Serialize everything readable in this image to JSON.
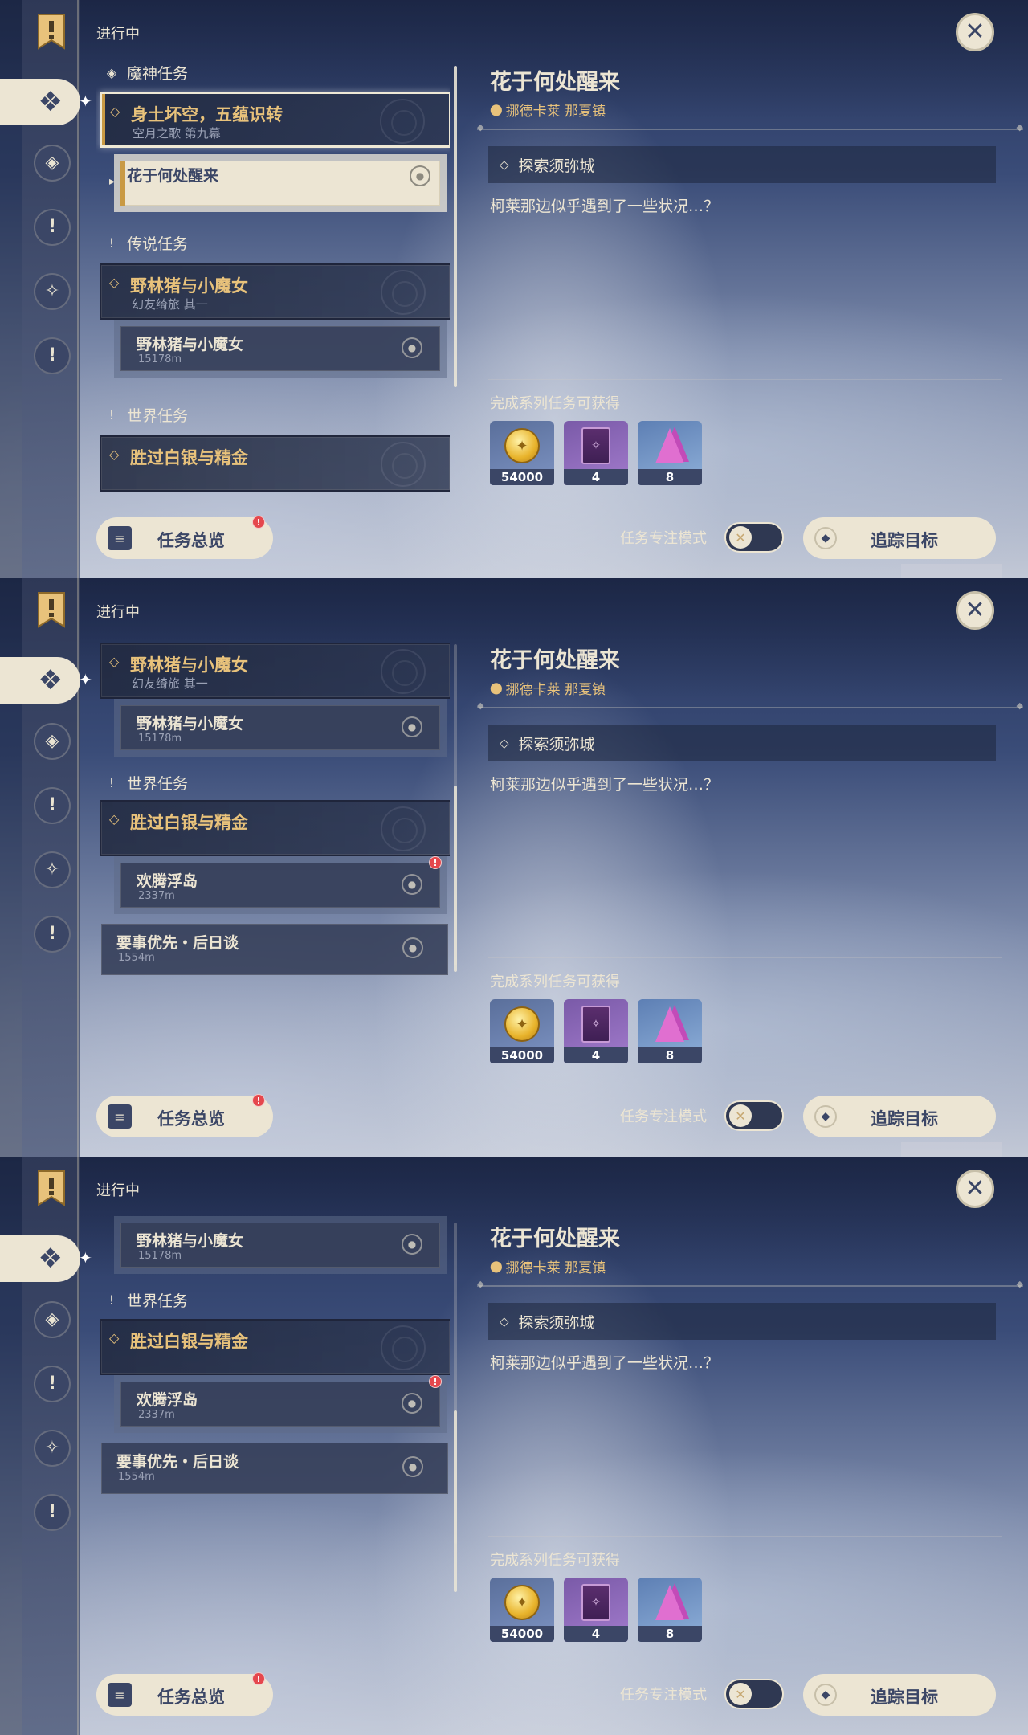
{
  "header": {
    "in_progress": "进行中"
  },
  "categories": {
    "archon": "魔神任务",
    "story": "传说任务",
    "world": "世界任务"
  },
  "quests": {
    "archon_group": {
      "title": "身土坏空，五蕴识转",
      "subtitle": "空月之歌 第九幕"
    },
    "archon_step": {
      "title": "花于何处醒来"
    },
    "story_group": {
      "title": "野林猪与小魔女",
      "subtitle": "幻友绮旅 其一"
    },
    "story_step": {
      "title": "野林猪与小魔女",
      "distance": "15178m"
    },
    "world_group": {
      "title": "胜过白银与精金"
    },
    "world_step": {
      "title": "欢腾浮岛",
      "distance": "2337m"
    },
    "world_other": {
      "title": "要事优先・后日谈",
      "distance": "1554m"
    }
  },
  "detail": {
    "title": "花于何处醒来",
    "location": "挪德卡莱 那夏镇",
    "step": "探索须弥城",
    "description": "柯莱那边似乎遇到了一些状况…？",
    "rewards_label": "完成系列任务可获得",
    "rewards": [
      {
        "name": "mora",
        "count": "54000"
      },
      {
        "name": "book",
        "count": "4"
      },
      {
        "name": "crystal",
        "count": "8"
      }
    ]
  },
  "footer": {
    "overview": "任务总览",
    "focus_mode": "任务专注模式",
    "track": "追踪目标"
  },
  "icons": {
    "bookmark": "bookmark-icon",
    "active_tab": "four-diamond-icon",
    "close": "close-icon",
    "pin": "map-pin-icon"
  },
  "colors": {
    "accent_gold": "#e8c27b",
    "cream": "#ece5d3",
    "navy": "#3b4666",
    "alert": "#e5474d"
  }
}
